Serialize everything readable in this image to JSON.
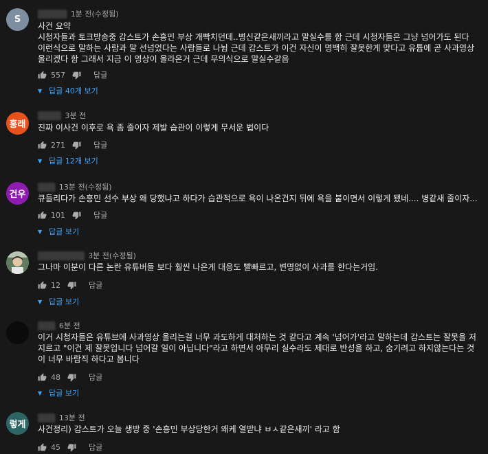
{
  "comments": [
    {
      "avatar": {
        "text": "S",
        "color": "#7d8fa0"
      },
      "name": "▇▇▇▇▇",
      "time": "1분 전(수정됨)",
      "text": "사건 요약\n시청자들과 토크방송중 감스트가 손흥민 부상 개빡치던데..병신같은새끼라고 말실수를 함 근데 시청자들은 그냥 넘어가도 된다 이런식으로 말하는 사람과 말 선넘었다는 사람들로 나뉨 근데 감스트가 이건 자신이 명백히 잘못한게 맞다고 유튭에 곧 사과영상 올리겠다 함 그래서 지금 이 영상이 올라온거 근데 무의식으로 말실수같음",
      "likes": "557",
      "reply_label": "답글",
      "replies_label": "답글 40개 보기"
    },
    {
      "avatar": {
        "text": "홍래",
        "color": "#e9511c"
      },
      "name": "▇▇▇▇",
      "time": "3분 전",
      "text": "진짜 이사건 이후로 욕 좀 줄이자 제발  습관이 이렇게 무서운 법이다",
      "likes": "271",
      "reply_label": "답글",
      "replies_label": "답글 12개 보기"
    },
    {
      "avatar": {
        "text": "건우",
        "color": "#8e1cb0"
      },
      "name": "▇▇▇",
      "time": "13분 전(수정됨)",
      "text": "큐들리다가 손흥민 선수 부상 왜 당했냐고 하다가 습관적으로 욕이 나온건지 뒤에 욕을 붙이면서 이렇게 됐네.... 병같새 줄이자...",
      "likes": "101",
      "reply_label": "답글",
      "replies_label": "답글 보기"
    },
    {
      "avatar": {
        "text": "",
        "color": "#4a6a4a"
      },
      "name": "▇▇▇▇▇▇▇▇",
      "time": "3분 전(수정됨)",
      "text": "그나마 이분이 다른 논란 유튜버들 보다 훨씬 나은게 대응도 빨빠르고, 변명없이 사과를 한다는거임.",
      "likes": "12",
      "reply_label": "답글",
      "replies_label": "답글 보기"
    },
    {
      "avatar": {
        "text": "",
        "color": "#0b0b0b"
      },
      "name": "▇▇▇",
      "time": "6분 전",
      "text": "이거 시청자들은 유튜브에 사과영상 올리는걸 너무 과도하게 대처하는 것 같다고 계속 '넘어가'라고 말하는데 감스트는 잘못을 저지르고 \"이건 제 잘못입니다 넘어갈 일이 아닙니다\"라고 하면서 아무리 실수라도 제대로 반성을 하고, 숨기려고 하지않는다는 것이 너무 바람직 하다고 봅니다",
      "likes": "48",
      "reply_label": "답글",
      "replies_label": "답글 보기"
    },
    {
      "avatar": {
        "text": "렇게",
        "color": "#2d6464"
      },
      "name": "▇▇▇",
      "time": "13분 전",
      "text": "사건정리) 감스트가 오늘 생방 중 '손흥민 부상당한거 왜케 열받냐 ㅂㅅ같은새끼'  라고 함",
      "likes": "45",
      "reply_label": "답글"
    }
  ]
}
